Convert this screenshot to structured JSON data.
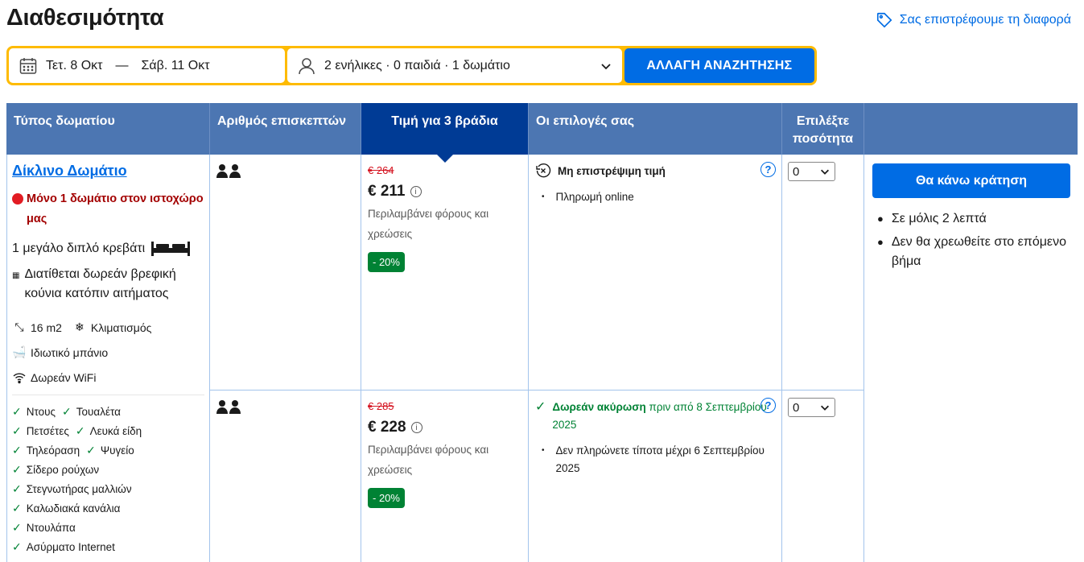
{
  "page": {
    "title": "Διαθεσιμότητα",
    "price_match": "Σας επιστρέφουμε τη διαφορά"
  },
  "search": {
    "checkin": "Τετ. 8 Οκτ",
    "separator": "—",
    "checkout": "Σάβ. 11 Οκτ",
    "guests": "2 ενήλικες · 0 παιδιά · 1 δωμάτιο",
    "button": "ΑΛΛΑΓΗ ΑΝΑΖΗΤΗΣΗΣ"
  },
  "table": {
    "headers": {
      "room_type": "Τύπος δωματίου",
      "guests": "Αριθμός επισκεπτών",
      "price": "Τιμή για 3 βράδια",
      "options": "Οι επιλογές σας",
      "quantity": "Επιλέξτε ποσότητα"
    }
  },
  "room": {
    "name": "Δίκλινο Δωμάτιο",
    "scarcity": "Μόνο 1 δωμάτιο στον ιστοχώρο μας",
    "bed": "1 μεγάλο διπλό κρεβάτι",
    "crib": "Διατίθεται δωρεάν βρεφική κούνια κατόπιν αιτήματος",
    "size": "16 m2",
    "ac": "Κλιματισμός",
    "bathroom": "Ιδιωτικό μπάνιο",
    "wifi": "Δωρεάν WiFi",
    "amenities": [
      "Ντους",
      "Τουαλέτα",
      "Πετσέτες",
      "Λευκά είδη",
      "Τηλεόραση",
      "Ψυγείο",
      "Σίδερο ρούχων",
      "Στεγνωτήρας μαλλιών",
      "Καλωδιακά κανάλια",
      "Ντουλάπα",
      "Ασύρματο Internet"
    ]
  },
  "rates": [
    {
      "old_price": "€ 264",
      "price": "€ 211",
      "taxes": "Περιλαμβάνει φόρους και χρεώσεις",
      "discount": "- 20%",
      "option_title": "Μη επιστρέψιμη τιμή",
      "option_title_suffix": "",
      "option_items": [
        "Πληρωμή online"
      ],
      "quantity": "0"
    },
    {
      "old_price": "€ 285",
      "price": "€ 228",
      "taxes": "Περιλαμβάνει φόρους και χρεώσεις",
      "discount": "- 20%",
      "option_title": "Δωρεάν ακύρωση",
      "option_title_suffix": " πριν από 8 Σεπτεμβρίου 2025",
      "option_items": [
        "Δεν πληρώνετε τίποτα μέχρι 6 Σεπτεμβρίου 2025"
      ],
      "quantity": "0"
    }
  ],
  "booking": {
    "button": "Θα κάνω κράτηση",
    "notes": [
      "Σε μόλις 2 λεπτά",
      "Δεν θα χρεωθείτε στο επόμενο βήμα"
    ]
  },
  "colors": {
    "brand_blue": "#006ce4",
    "header_blue": "#4c76b2",
    "dark_blue": "#003b95",
    "search_yellow": "#febb02",
    "green": "#008234",
    "red": "#d4111e"
  }
}
